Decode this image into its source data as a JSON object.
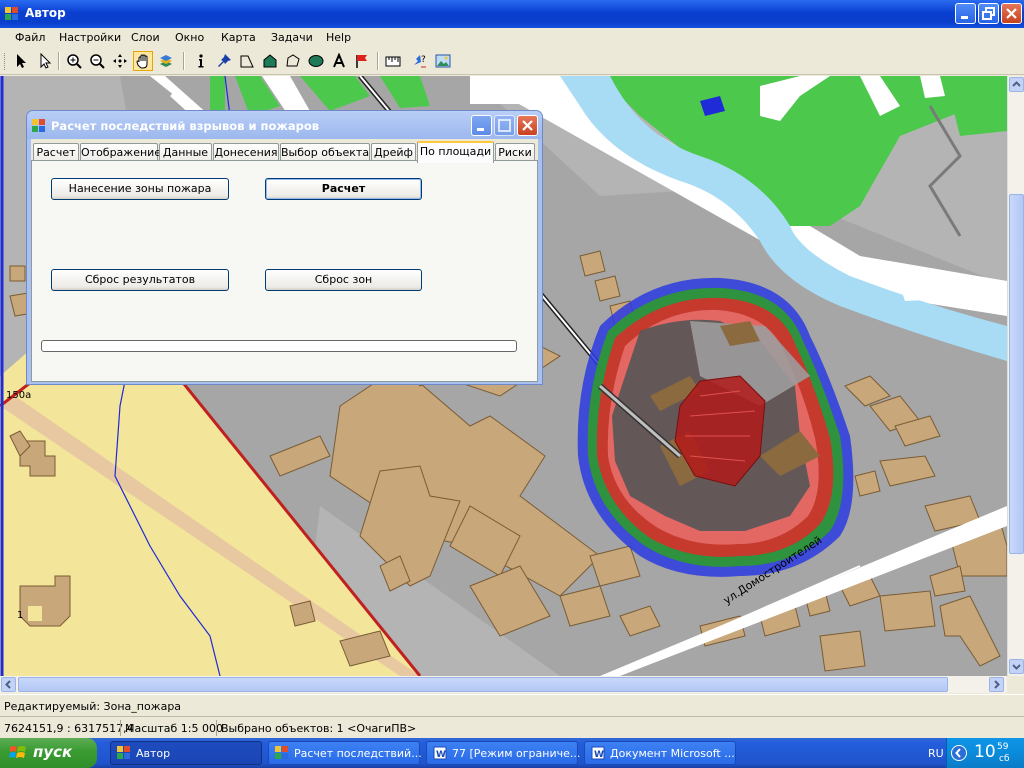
{
  "window": {
    "title": "Автор"
  },
  "menu": [
    "Файл",
    "Настройки",
    "Слои",
    "Окно",
    "Карта",
    "Задачи",
    "Help"
  ],
  "toolbar": {
    "tools": [
      "select-arrow-icon",
      "select-area-icon",
      "zoom-in-icon",
      "zoom-out-icon",
      "pan-icon",
      "hand-icon",
      "layers-icon",
      "info-icon",
      "pin-icon",
      "line-icon",
      "polygon-icon",
      "polyline-icon",
      "ellipse-icon",
      "text-icon",
      "flag-icon",
      "measure-icon",
      "query-icon",
      "image-icon"
    ],
    "active_tool": "hand-icon"
  },
  "dialog": {
    "title": "Расчет последствий взрывов и пожаров",
    "tabs": [
      "Расчет",
      "Отображение",
      "Данные",
      "Донесения",
      "Выбор объекта",
      "Дрейф",
      "По площади",
      "Риски"
    ],
    "active_tab": "По площади",
    "buttons": {
      "fire_zone": "Нанесение зоны пожара",
      "calculate": "Расчет",
      "reset_results": "Сброс результатов",
      "reset_zones": "Сброс зон"
    },
    "progress": 0
  },
  "map": {
    "labels": {
      "street": "ул.Домостроителей",
      "house_a": "150а",
      "house_b": "1"
    },
    "colors": {
      "background": "#B4B4B4",
      "road": "#FFFFFF",
      "green": "#4CC84C",
      "water": "#A8DCF5",
      "building": "#C8A77A",
      "sand": "#F3E59A",
      "zone_blue": "#2B3AE0",
      "zone_green": "#2E9A2E",
      "zone_red": "#E02A2A",
      "zone_dark": "#555555",
      "epicenter": "#B21A1A"
    }
  },
  "status": {
    "editing": "Редактируемый: Зона_пожара",
    "coords": "7624151,9 : 6317517,4",
    "scale": "Масштаб 1:5 000",
    "selected": "Выбрано объектов: 1 <ОчагиПВ>"
  },
  "taskbar": {
    "start": "пуск",
    "tasks": [
      "Автор",
      "Расчет последствий...",
      "77 [Режим ограниче...",
      "Документ Microsoft ..."
    ],
    "lang": "RU",
    "clock_hour": "10",
    "clock_min": "59",
    "clock_day": "сб"
  }
}
